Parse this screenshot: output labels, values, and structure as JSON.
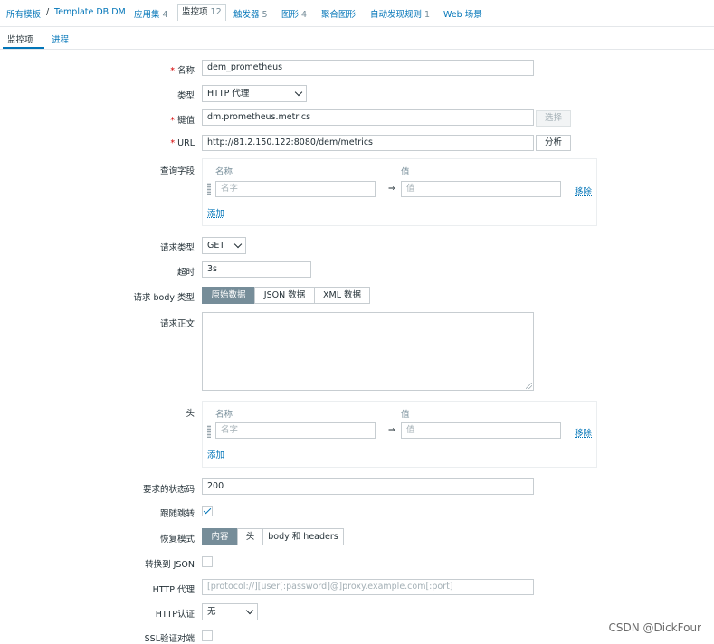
{
  "breadcrumb": {
    "all_templates": "所有模板",
    "separator": "/",
    "template": "Template DB DM",
    "apps": "应用集",
    "apps_count": "4",
    "items": "监控项",
    "items_count": "12",
    "triggers": "触发器",
    "triggers_count": "5",
    "graphs": "图形",
    "graphs_count": "4",
    "aggregate": "聚合图形",
    "discovery": "自动发现规则",
    "discovery_count": "1",
    "web": "Web 场景"
  },
  "tabs": [
    "监控项",
    "进程"
  ],
  "form": {
    "name_label": "名称",
    "name_value": "dem_prometheus",
    "type_label": "类型",
    "type_value": "HTTP 代理",
    "key_label": "键值",
    "key_value": "dm.prometheus.metrics",
    "key_button": "选择",
    "url_label": "URL",
    "url_value": "http://81.2.150.122:8080/dem/metrics",
    "url_button": "分析",
    "query_label": "查询字段",
    "col_name": "名称",
    "col_value": "值",
    "name_placeholder": "名字",
    "value_placeholder": "值",
    "arrow": "⇒",
    "remove": "移除",
    "add": "添加",
    "req_type_label": "请求类型",
    "req_type_value": "GET",
    "timeout_label": "超时",
    "timeout_value": "3s",
    "body_type_label": "请求 body 类型",
    "body_types": [
      "原始数据",
      "JSON 数据",
      "XML 数据"
    ],
    "body_label": "请求正文",
    "headers_label": "头",
    "status_label": "要求的状态码",
    "status_value": "200",
    "follow_label": "跟随跳转",
    "follow_checked": true,
    "retrieve_label": "恢复模式",
    "retrieve_modes": [
      "内容",
      "头",
      "body 和 headers"
    ],
    "json_label": "转换到 JSON",
    "json_checked": false,
    "proxy_label": "HTTP 代理",
    "proxy_placeholder": "[protocol://][user[:password]@]proxy.example.com[:port]",
    "auth_label": "HTTP认证",
    "auth_value": "无",
    "ssl_label": "SSL验证对端",
    "ssl_checked": false
  },
  "watermark": "CSDN @DickFour",
  "colors": {
    "link": "#0275b8",
    "active_segment": "#768d99",
    "required": "#d40000"
  }
}
